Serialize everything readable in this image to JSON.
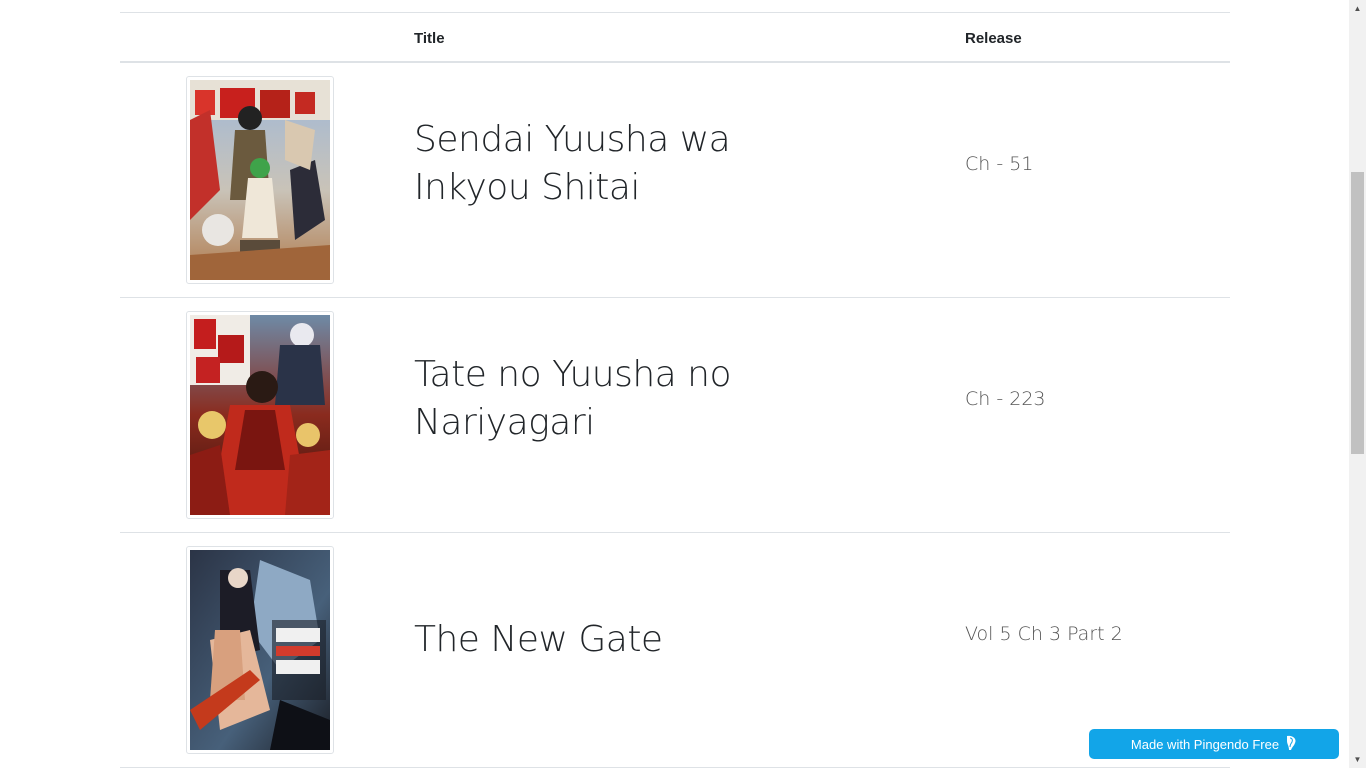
{
  "table": {
    "headers": {
      "title": "Title",
      "release": "Release"
    },
    "rows": [
      {
        "title": "Sendai Yuusha wa Inkyou Shitai",
        "release": "Ch - 51"
      },
      {
        "title": "Tate no Yuusha no Nariyagari",
        "release": "Ch - 223"
      },
      {
        "title": "The New Gate",
        "release": "Vol 5 Ch 3 Part 2"
      }
    ]
  },
  "badge": {
    "label": "Made with Pingendo Free",
    "icon": "pingendo-logo-icon"
  },
  "colors": {
    "badge_bg": "#12a5e8",
    "rule": "#dee2e6",
    "text": "#212529"
  }
}
